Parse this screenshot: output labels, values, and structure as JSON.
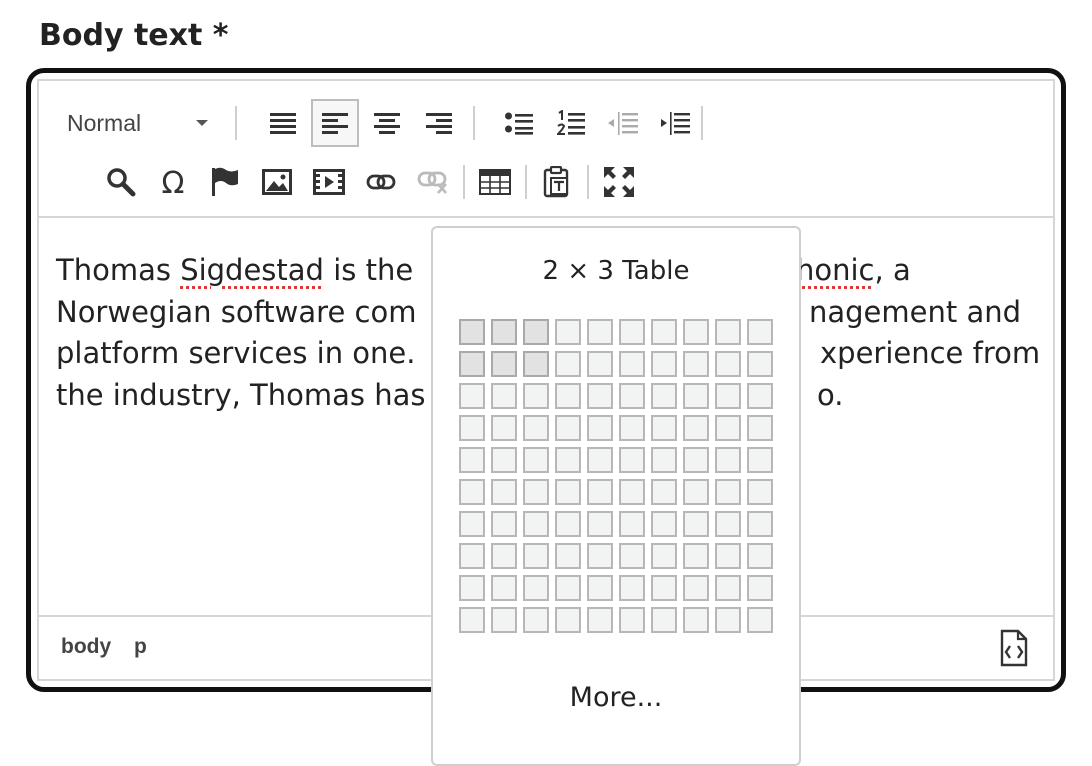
{
  "field": {
    "label": "Body text *"
  },
  "toolbar": {
    "format_select": {
      "value": "Normal"
    },
    "row1": [
      {
        "name": "align-justify-icon",
        "active": false
      },
      {
        "name": "align-left-icon",
        "active": true
      },
      {
        "name": "align-center-icon",
        "active": false
      },
      {
        "name": "align-right-icon",
        "active": false
      },
      {
        "name": "bullet-list-icon",
        "active": false
      },
      {
        "name": "numbered-list-icon",
        "active": false
      },
      {
        "name": "outdent-icon",
        "active": false
      },
      {
        "name": "indent-icon",
        "active": false
      }
    ],
    "row2": [
      {
        "name": "search-icon"
      },
      {
        "name": "special-character-icon"
      },
      {
        "name": "anchor-flag-icon"
      },
      {
        "name": "image-icon"
      },
      {
        "name": "video-icon"
      },
      {
        "name": "link-icon"
      },
      {
        "name": "unlink-icon"
      },
      {
        "name": "table-icon"
      },
      {
        "name": "paste-as-text-icon"
      },
      {
        "name": "fullscreen-icon"
      }
    ]
  },
  "content": {
    "line1_a": "Thomas ",
    "line1_misspelled": "Sigdestad",
    "line1_b": " is the ",
    "line1_right_a": "",
    "line1_right_misspelled": "honic",
    "line1_right_b": ", a",
    "line2_left": "Norwegian software com",
    "line2_right": "nagement and",
    "line3_left": "platform services in one. ",
    "line3_right": "xperience from",
    "line4_left": "the industry, Thomas has",
    "line4_right": "o."
  },
  "statusbar": {
    "path": [
      "body",
      "p"
    ],
    "source_icon": "source-code-icon"
  },
  "table_picker": {
    "title": "2 × 3 Table",
    "rows": 10,
    "cols": 10,
    "selected_rows": 2,
    "selected_cols": 3,
    "more_label": "More..."
  },
  "colors": {
    "border_focus": "#111111",
    "cell_bg": "#f2f4f4",
    "cell_selected": "#e2e2e2"
  }
}
